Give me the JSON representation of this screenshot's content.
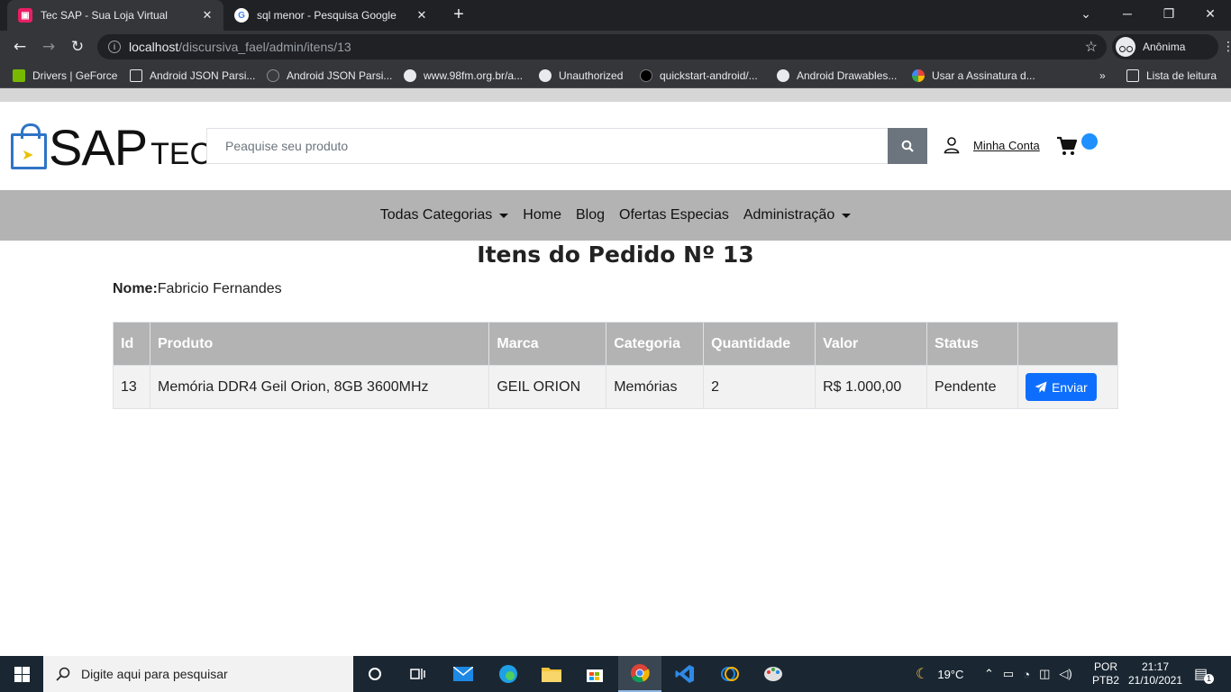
{
  "browser": {
    "tabs": [
      {
        "title": "Tec SAP - Sua Loja Virtual",
        "active": true
      },
      {
        "title": "sql menor - Pesquisa Google",
        "active": false
      }
    ],
    "url_host": "localhost",
    "url_path": "/discursiva_fael/admin/itens/13",
    "profile_label": "Anônima",
    "bookmarks": [
      "Drivers | GeForce",
      "Android JSON Parsi...",
      "Android JSON Parsi...",
      "www.98fm.org.br/a...",
      "Unauthorized",
      "quickstart-android/...",
      "Android Drawables...",
      "Usar a Assinatura d..."
    ],
    "reading_list_label": "Lista de leitura"
  },
  "site": {
    "logo_main": "SAP",
    "logo_sub": "TEC",
    "search_placeholder": "Peaquise seu produto",
    "account_label": "Minha Conta",
    "nav": [
      {
        "label": "Todas Categorias",
        "dropdown": true
      },
      {
        "label": "Home",
        "dropdown": false
      },
      {
        "label": "Blog",
        "dropdown": false
      },
      {
        "label": "Ofertas Especias",
        "dropdown": false
      },
      {
        "label": "Administração",
        "dropdown": true
      }
    ]
  },
  "order": {
    "title": "Itens do Pedido Nº 13",
    "customer_label": "Nome:",
    "customer_name": "Fabricio Fernandes",
    "columns": [
      "Id",
      "Produto",
      "Marca",
      "Categoria",
      "Quantidade",
      "Valor",
      "Status",
      ""
    ],
    "rows": [
      {
        "id": "13",
        "produto": "Memória DDR4 Geil Orion, 8GB 3600MHz",
        "marca": "GEIL ORION",
        "categoria": "Memórias",
        "quantidade": "2",
        "valor": "R$ 1.000,00",
        "status": "Pendente",
        "action_label": "Enviar"
      }
    ]
  },
  "taskbar": {
    "search_placeholder": "Digite aqui para pesquisar",
    "weather": "19°C",
    "lang_top": "POR",
    "lang_bottom": "PTB2",
    "time": "21:17",
    "date": "21/10/2021",
    "notifications": "1"
  },
  "colors": {
    "accent_blue": "#0d6efd",
    "header_gray": "#b3b3b3",
    "logo_blue": "#2f74c6",
    "cart_badge": "#1e90ff"
  }
}
